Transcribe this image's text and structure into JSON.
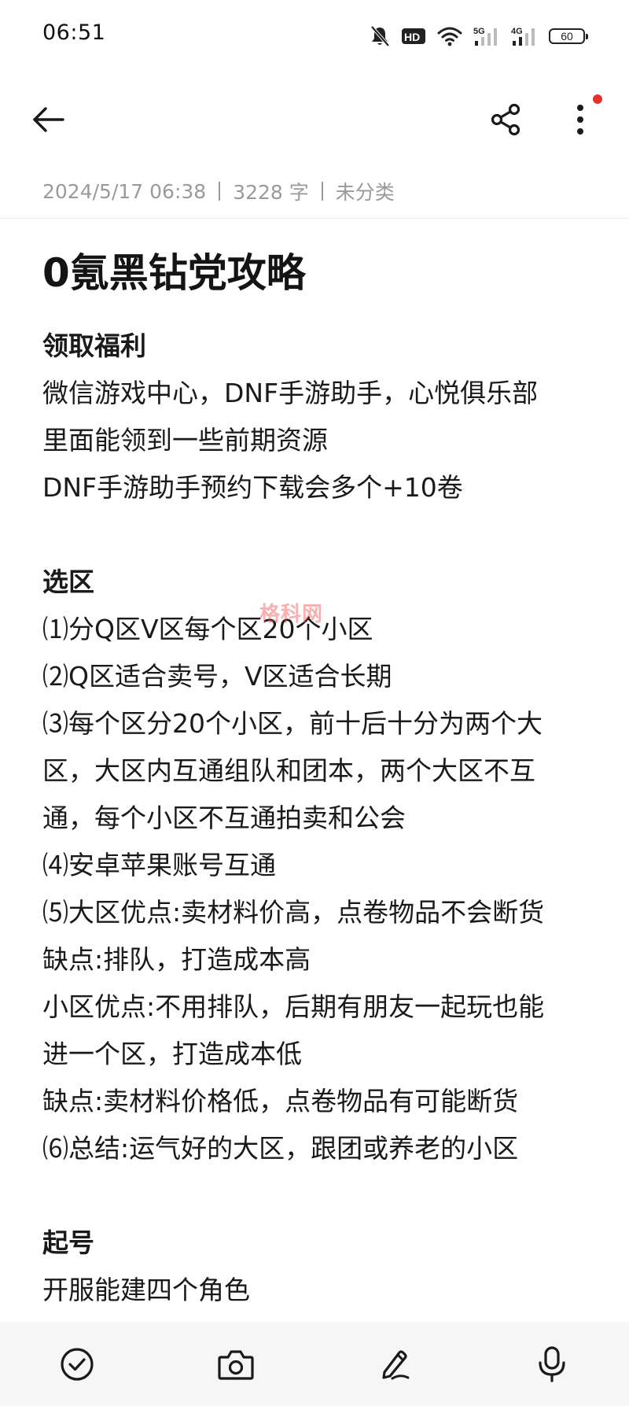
{
  "status_bar": {
    "time": "06:51",
    "hd_badge": "HD",
    "network_1": "5G",
    "network_2": "4G",
    "battery_level": "60",
    "icons": [
      "bell-muted-icon",
      "hd-icon",
      "wifi-icon",
      "signal-5g-icon",
      "signal-4g-icon",
      "battery-icon"
    ]
  },
  "toolbar": {
    "icons": [
      "back-arrow-icon",
      "share-icon",
      "more-vertical-icon"
    ],
    "notification_dot_color": "#e5302b"
  },
  "meta": {
    "date": "2024/5/17 06:38",
    "word_count": "3228 字",
    "category": "未分类"
  },
  "note": {
    "title": "0氪黑钻党攻略",
    "lines": [
      "领取福利",
      "微信游戏中心，DNF手游助手，心悦俱乐部",
      "里面能领到一些前期资源",
      "DNF手游助手预约下载会多个+10卷",
      "",
      "选区",
      "⑴分Q区V区每个区20个小区",
      "⑵Q区适合卖号，V区适合长期",
      "⑶每个区分20个小区，前十后十分为两个大",
      "区，大区内互通组队和团本，两个大区不互",
      "通，每个小区不互通拍卖和公会",
      "⑷安卓苹果账号互通",
      "⑸大区优点:卖材料价高，点卷物品不会断货",
      "缺点:排队，打造成本高",
      "小区优点:不用排队，后期有朋友一起玩也能",
      "进一个区，打造成本低",
      "缺点:卖材料价格低，点卷物品有可能断货",
      "⑹总结:运气好的大区，跟团或养老的小区",
      "",
      "起号",
      "开服能建四个角色"
    ]
  },
  "watermark": "格科网",
  "bottom_bar": {
    "icons": [
      "checklist-icon",
      "camera-icon",
      "pen-icon",
      "microphone-icon"
    ]
  }
}
